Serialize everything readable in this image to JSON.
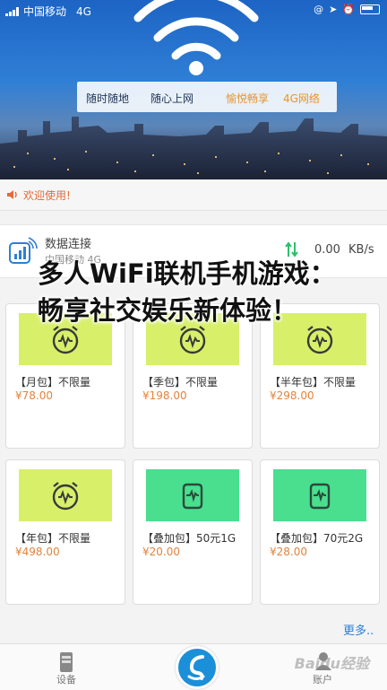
{
  "status_bar": {
    "carrier": "中国移动",
    "network": "4G"
  },
  "banner": {
    "slogan_1": "随时随地",
    "slogan_2": "随心上网",
    "slogan_3": "愉悦畅享",
    "slogan_4": "4G网络"
  },
  "welcome": {
    "text": "欢迎使用!"
  },
  "connection": {
    "title": "数据连接",
    "carrier": "中国移动 4G",
    "speed": "0.00",
    "unit": "KB/s"
  },
  "headline": "多人WiFi联机手机游戏：畅享社交娱乐新体验！",
  "packages": [
    {
      "name": "【月包】不限量",
      "price": "¥78.00",
      "color": "#d8ef6a",
      "icon": "alarm-clock-icon"
    },
    {
      "name": "【季包】不限量",
      "price": "¥198.00",
      "color": "#d8ef6a",
      "icon": "alarm-clock-icon"
    },
    {
      "name": "【半年包】不限量",
      "price": "¥298.00",
      "color": "#d8ef6a",
      "icon": "alarm-clock-icon"
    },
    {
      "name": "【年包】不限量",
      "price": "¥498.00",
      "color": "#d8ef6a",
      "icon": "alarm-clock-icon"
    },
    {
      "name": "【叠加包】50元1G",
      "price": "¥20.00",
      "color": "#49df8f",
      "icon": "data-pack-icon"
    },
    {
      "name": "【叠加包】70元2G",
      "price": "¥28.00",
      "color": "#49df8f",
      "icon": "data-pack-icon"
    }
  ],
  "more_link": "更多..",
  "tabbar": {
    "device_label": "设备",
    "account_label": "账户"
  },
  "watermark": "Baidu经验",
  "colors": {
    "accent": "#2d7fd6",
    "price": "#e3833e",
    "welcome": "#e46a3a"
  }
}
